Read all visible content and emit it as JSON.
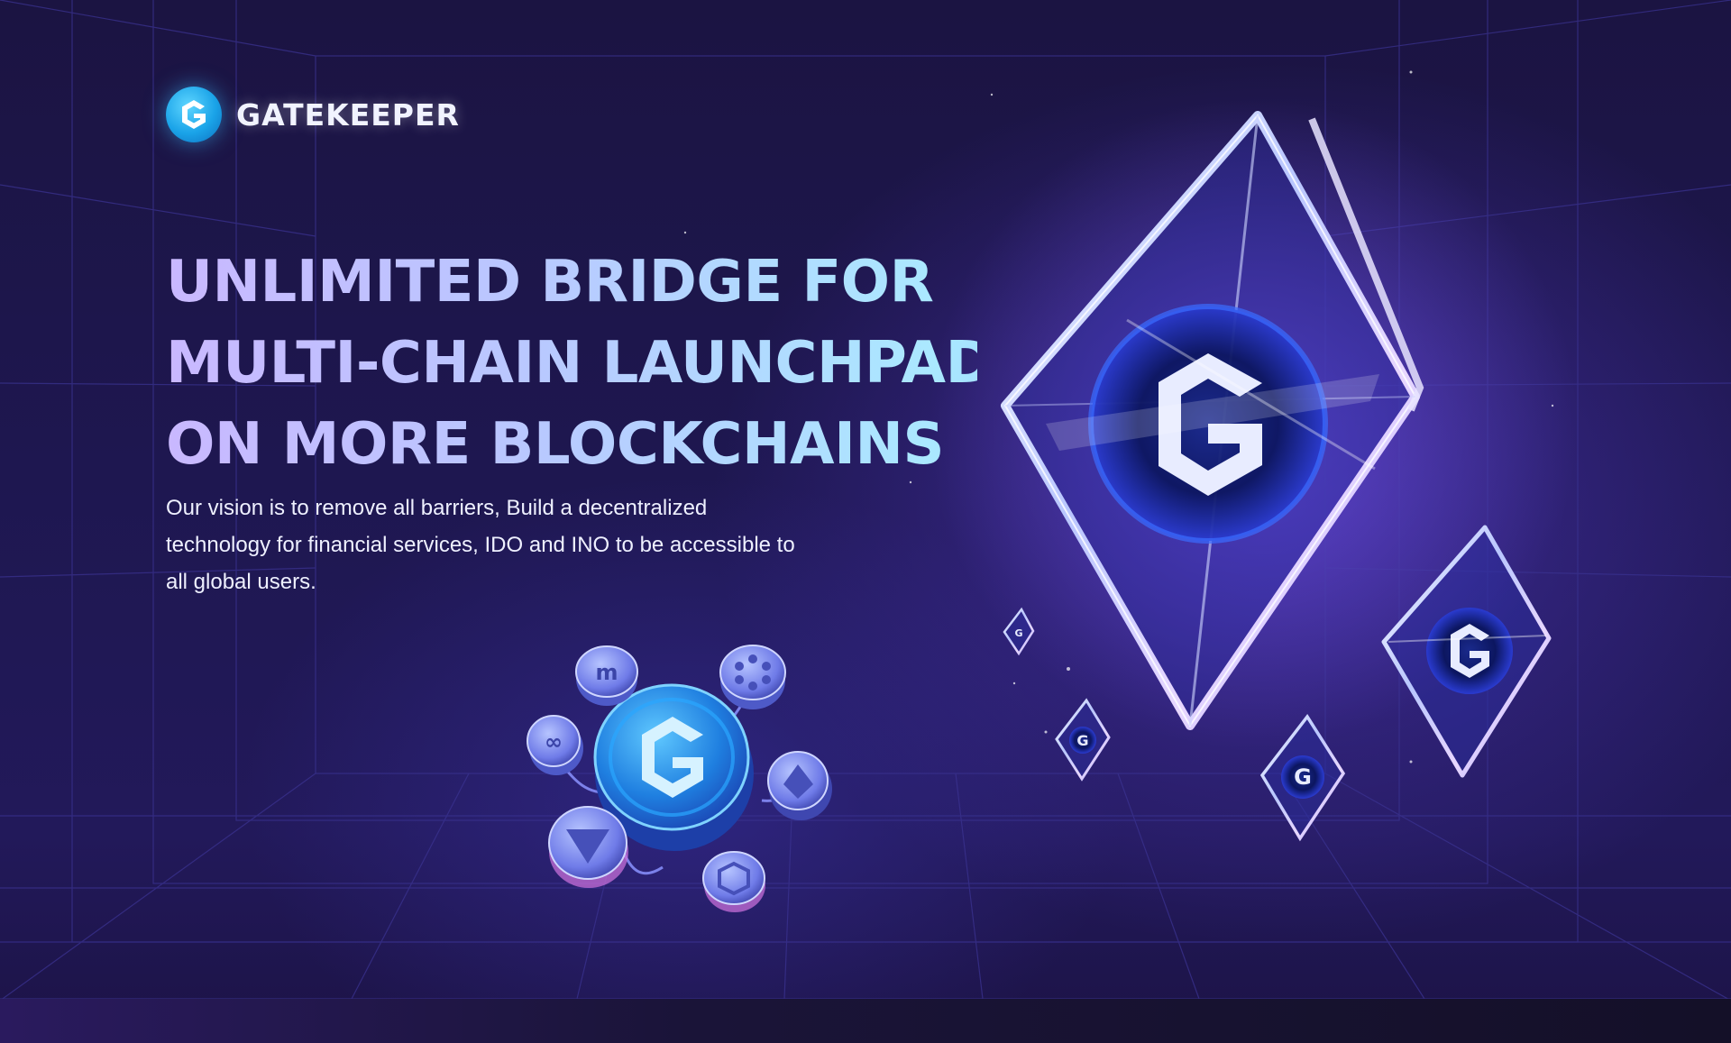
{
  "brand": {
    "name": "GATEKEEPER",
    "logo_icon": "gatekeeper-g-icon",
    "accent": "#1aa3e8"
  },
  "hero": {
    "title_lines": [
      "UNLIMITED BRIDGE FOR",
      "MULTI-CHAIN LAUNCHPAD",
      "ON MORE BLOCKCHAINS"
    ],
    "description": "Our vision is to remove all barriers, Build a decentralized technology for financial services, IDO and INO to be accessible to all global users."
  },
  "illustration": {
    "hub_icon": "gatekeeper-coin-icon",
    "chain_icons": [
      "polygon-coin-icon",
      "polkadot-coin-icon",
      "multichain-coin-icon",
      "ethereum-coin-icon",
      "tron-coin-icon",
      "chain-link-coin-icon"
    ],
    "crystal_icon": "crystal-g-token-icon"
  },
  "colors": {
    "background": "#1b1442",
    "title_gradient_start": "#c9b8ff",
    "title_gradient_end": "#a9ecff",
    "glow": "#5a3cd2"
  }
}
